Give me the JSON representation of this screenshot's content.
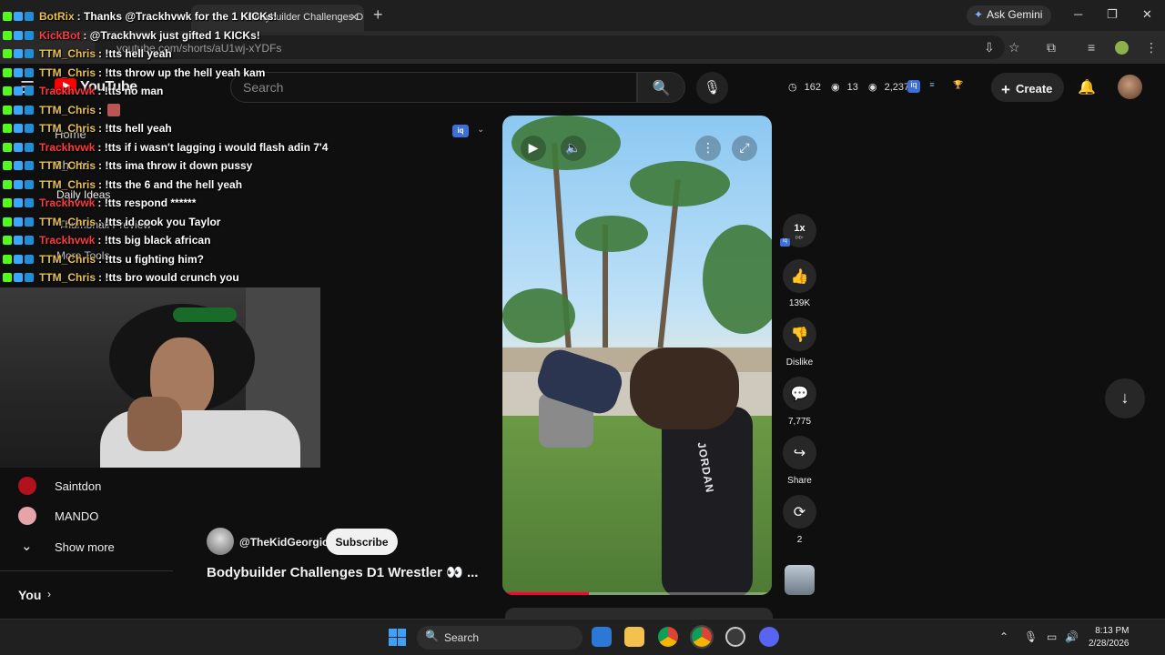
{
  "browser": {
    "tab_title": "Bodybuilder Challenges D1 Wrestler",
    "close_tab": "✕",
    "new_tab": "+",
    "ask_gemini": "Ask Gemini",
    "url": "youtube.com/shorts/aU1wj-xYDFs",
    "window_minimize": "─",
    "window_restore": "❐",
    "window_close": "✕"
  },
  "youtube": {
    "logo_text": "YouTube",
    "search_placeholder": "Search",
    "stats": {
      "likes_stat": "162",
      "views_stat": "13",
      "eye_stat": "2,237"
    },
    "create_label": "Create"
  },
  "sidebar": {
    "items": [
      {
        "label": "Home"
      },
      {
        "label": "Shorts"
      },
      {
        "label": "Daily Ideas"
      },
      {
        "label": "Thumbnail Preview"
      },
      {
        "label": "More Tools"
      }
    ],
    "channels": [
      {
        "name": "Saintdon",
        "color": "#b3121c"
      },
      {
        "name": "MANDO",
        "color": "#e6a3a8"
      }
    ],
    "show_more": "Show more",
    "you_label": "You"
  },
  "chat": {
    "messages": [
      {
        "user": "BotRix",
        "user_color": "#e8c14a",
        "text": ": Thanks @Trackhvwk for the 1 KICKs!"
      },
      {
        "user": "KickBot",
        "user_color": "#ff3b3b",
        "text": ": @Trackhvwk just gifted 1 KICKs!"
      },
      {
        "user": "TTM_Chris",
        "user_color": "#e8c14a",
        "text": ": !tts hell yeah"
      },
      {
        "user": "TTM_Chris",
        "user_color": "#e8c14a",
        "text": ": !tts throw up the hell yeah kam"
      },
      {
        "user": "Trackhvwk",
        "user_color": "#ff3b3b",
        "text": ": !tts no man"
      },
      {
        "user": "TTM_Chris",
        "user_color": "#e8c14a",
        "text": ":",
        "emote": true
      },
      {
        "user": "TTM_Chris",
        "user_color": "#e8c14a",
        "text": ": !tts hell yeah"
      },
      {
        "user": "Trackhvwk",
        "user_color": "#ff3b3b",
        "text": ": !tts if i wasn't lagging i would flash adin 7'4"
      },
      {
        "user": "TTM_Chris",
        "user_color": "#e8c14a",
        "text": ": !tts ima throw it down pussy"
      },
      {
        "user": "TTM_Chris",
        "user_color": "#e8c14a",
        "text": ": !tts the 6 and the hell yeah"
      },
      {
        "user": "Trackhvwk",
        "user_color": "#ff3b3b",
        "text": ": !tts respond ******"
      },
      {
        "user": "TTM_Chris",
        "user_color": "#e8c14a",
        "text": ": !tts id cook you Taylor"
      },
      {
        "user": "Trackhvwk",
        "user_color": "#ff3b3b",
        "text": ": !tts big black african"
      },
      {
        "user": "TTM_Chris",
        "user_color": "#e8c14a",
        "text": ": !tts u fighting him?"
      },
      {
        "user": "TTM_Chris",
        "user_color": "#e8c14a",
        "text": ": !tts bro would crunch you"
      }
    ]
  },
  "short": {
    "watermark_text": "JORDAN",
    "progress": 0.32,
    "channel": "@TheKidGeorgio",
    "subscribe_label": "Subscribe",
    "title": "Bodybuilder Challenges D1 Wrestler 👀 ..."
  },
  "actions": {
    "speed": "1x",
    "speed_sub": "▹▹",
    "like_count": "139K",
    "dislike_label": "Dislike",
    "comment_count": "7,775",
    "share_label": "Share",
    "remix_count": "2"
  },
  "taskbar": {
    "search_label": "Search",
    "time": "8:13 PM",
    "date": "2/28/2026"
  },
  "colors": {
    "accent_red": "#ff0000",
    "progress_red": "#ff0033",
    "kick_green": "#53fc18"
  }
}
